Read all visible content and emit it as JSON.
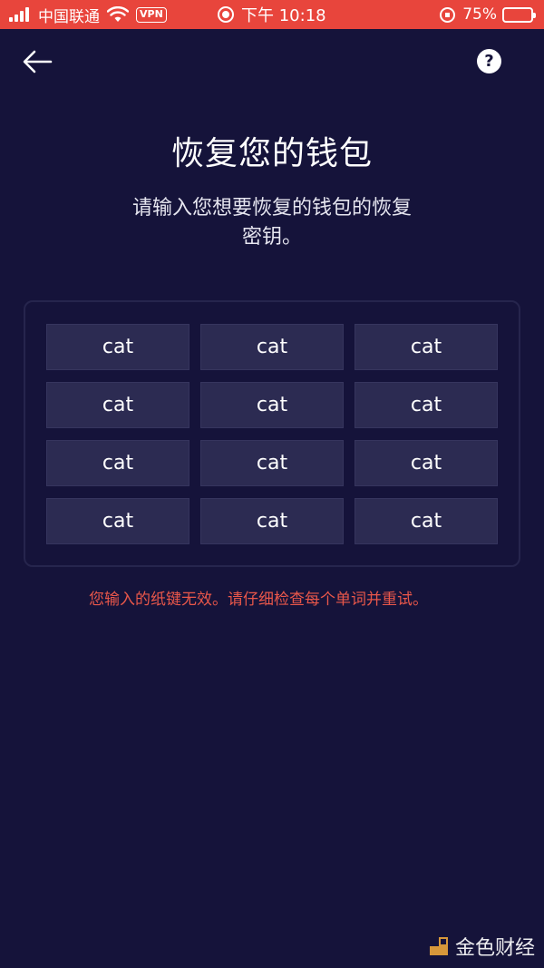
{
  "status_bar": {
    "carrier": "中国联通",
    "vpn": "VPN",
    "time": "下午 10:18",
    "battery": "75%"
  },
  "nav": {
    "help_label": "?"
  },
  "header": {
    "title": "恢复您的钱包",
    "subtitle_line1": "请输入您想要恢复的钱包的恢复",
    "subtitle_line2": "密钥。"
  },
  "words": [
    "cat",
    "cat",
    "cat",
    "cat",
    "cat",
    "cat",
    "cat",
    "cat",
    "cat",
    "cat",
    "cat",
    "cat"
  ],
  "error": "您输入的纸键无效。请仔细检查每个单词并重试。",
  "watermark": "金色财经",
  "colors": {
    "background": "#15133a",
    "status_bar": "#e8453c",
    "error": "#e9574a",
    "word_cell": "#2c2b52"
  }
}
